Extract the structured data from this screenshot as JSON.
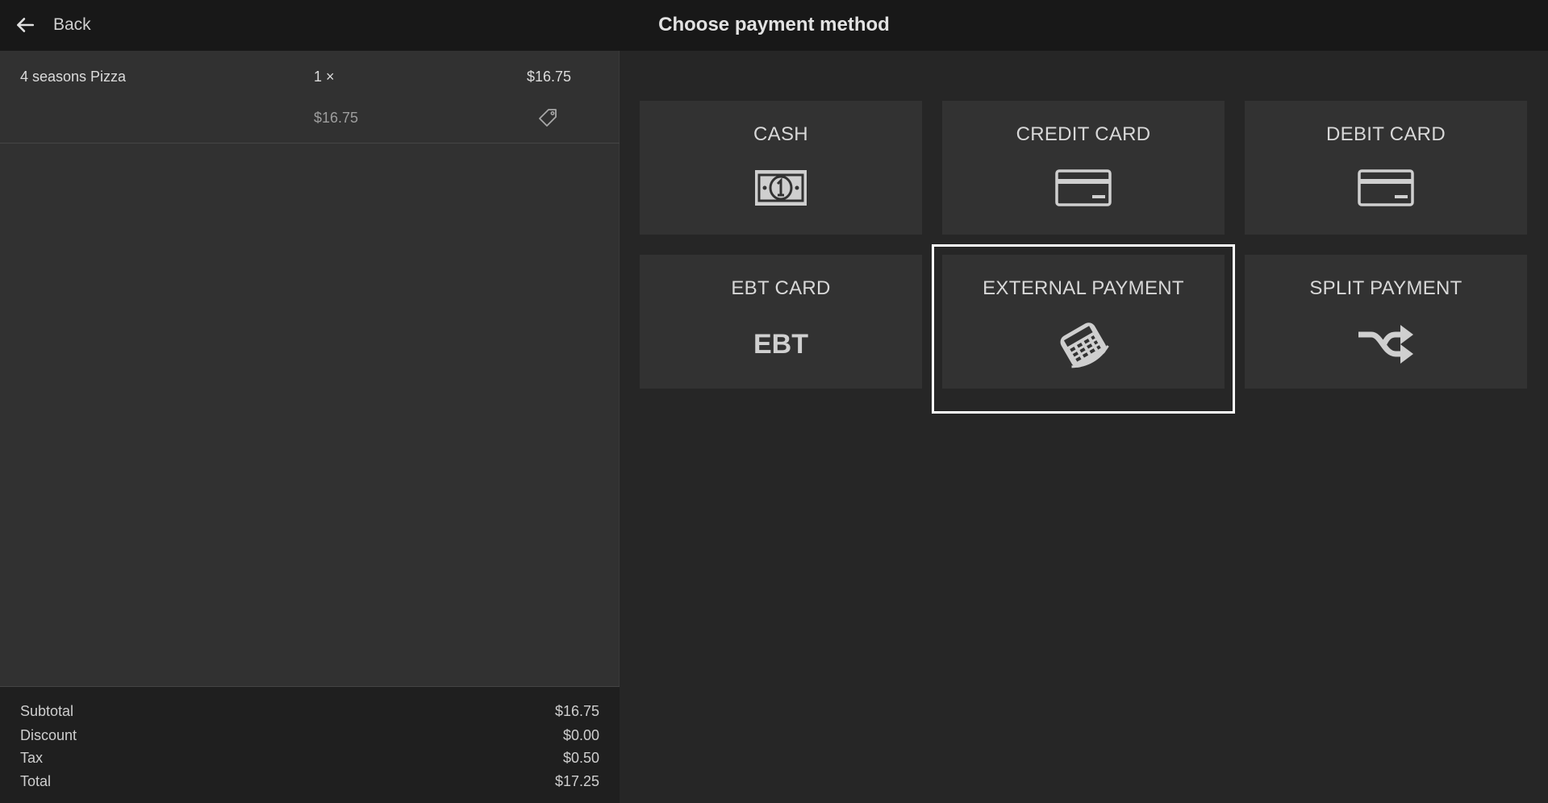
{
  "header": {
    "back_label": "Back",
    "title": "Choose payment method"
  },
  "order": {
    "items": [
      {
        "name": "4 seasons Pizza",
        "qty": "1 ×",
        "total": "$16.75",
        "unit_price": "$16.75"
      }
    ]
  },
  "summary": {
    "subtotal_label": "Subtotal",
    "subtotal_value": "$16.75",
    "discount_label": "Discount",
    "discount_value": "$0.00",
    "tax_label": "Tax",
    "tax_value": "$0.50",
    "total_label": "Total",
    "total_value": "$17.25"
  },
  "payment_methods": [
    {
      "label": "CASH",
      "icon": "cash-icon"
    },
    {
      "label": "CREDIT CARD",
      "icon": "credit-card-icon"
    },
    {
      "label": "DEBIT CARD",
      "icon": "debit-card-icon"
    },
    {
      "label": "EBT CARD",
      "icon": "ebt-icon",
      "icon_text": "EBT"
    },
    {
      "label": "EXTERNAL PAYMENT",
      "icon": "card-terminal-icon",
      "selected": true
    },
    {
      "label": "SPLIT PAYMENT",
      "icon": "shuffle-icon"
    }
  ],
  "colors": {
    "header_bg": "#181818",
    "left_panel_bg": "#313131",
    "right_panel_bg": "#262626",
    "tile_bg": "#323232",
    "highlight": "#ffffff"
  }
}
